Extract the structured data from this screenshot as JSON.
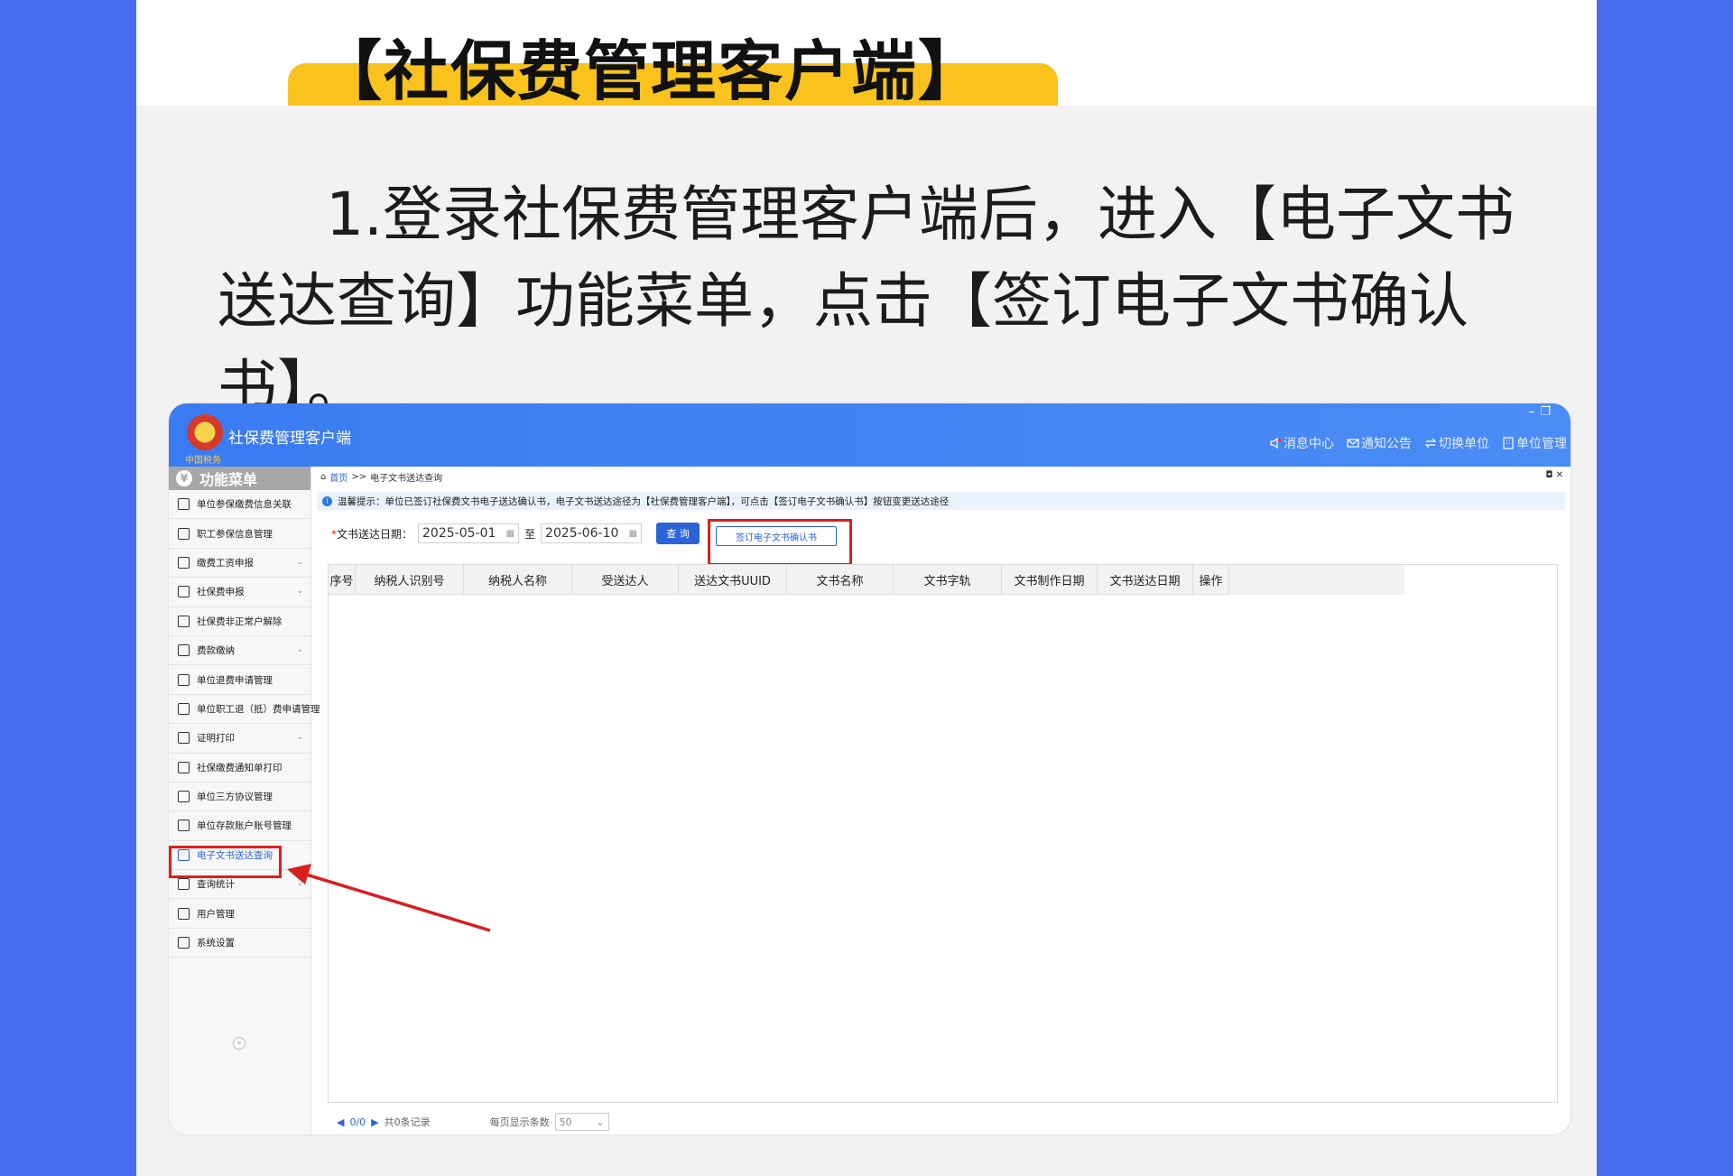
{
  "poster": {
    "title": "【社保费管理客户端】",
    "instruction": "1.登录社保费管理客户端后，进入【电子文书送达查询】功能菜单，点击【签订电子文书确认书】。"
  },
  "app": {
    "name": "社保费管理客户端",
    "logo_subtext": "中国税务",
    "window_controls": {
      "minimize": "–",
      "restore": "❐"
    },
    "header_links": [
      {
        "icon": "speaker-icon",
        "label": "消息中心"
      },
      {
        "icon": "mail-icon",
        "label": "通知公告"
      },
      {
        "icon": "swap-icon",
        "label": "切换单位"
      },
      {
        "icon": "building-icon",
        "label": "单位管理"
      }
    ]
  },
  "sidebar": {
    "title": "功能菜单",
    "items": [
      {
        "label": "单位参保缴费信息关联",
        "expandable": false
      },
      {
        "label": "职工参保信息管理",
        "expandable": false
      },
      {
        "label": "缴费工资申报",
        "expandable": true
      },
      {
        "label": "社保费申报",
        "expandable": true
      },
      {
        "label": "社保费非正常户解除",
        "expandable": false
      },
      {
        "label": "费款缴纳",
        "expandable": true
      },
      {
        "label": "单位退费申请管理",
        "expandable": false
      },
      {
        "label": "单位职工退（抵）费申请管理",
        "expandable": false
      },
      {
        "label": "证明打印",
        "expandable": true
      },
      {
        "label": "社保缴费通知单打印",
        "expandable": false
      },
      {
        "label": "单位三方协议管理",
        "expandable": false
      },
      {
        "label": "单位存款账户账号管理",
        "expandable": false
      },
      {
        "label": "电子文书送达查询",
        "expandable": false,
        "active": true
      },
      {
        "label": "查询统计",
        "expandable": true
      },
      {
        "label": "用户管理",
        "expandable": false
      },
      {
        "label": "系统设置",
        "expandable": false
      }
    ],
    "collapse_symbol": "«"
  },
  "content": {
    "breadcrumb": {
      "home": "首页",
      "separator": ">>",
      "current": "电子文书送达查询"
    },
    "tab_controls": "◘ ✕",
    "notice": "温馨提示：单位已签订社保费文书电子送达确认书，电子文书送达途径为【社保费管理客户端】，可点击【签订电子文书确认书】按钮变更送达途径",
    "filter": {
      "required_mark": "*",
      "label": "文书送达日期：",
      "start_date": "2025-05-01",
      "to": "至",
      "end_date": "2025-06-10",
      "query_button": "查 询",
      "sign_button": "签订电子文书确认书"
    },
    "table": {
      "columns": [
        "序号",
        "纳税人识别号",
        "纳税人名称",
        "受送达人",
        "送达文书UUID",
        "文书名称",
        "文书字轨",
        "文书制作日期",
        "文书送达日期",
        "操作"
      ],
      "rows": []
    },
    "pager": {
      "pages": "0/0",
      "total": "共0条记录",
      "per_page_label": "每页显示条数",
      "per_page_value": "50"
    }
  },
  "colors": {
    "accent_blue": "#2c64d8",
    "header_blue": "#3b7bf2",
    "highlight_red": "#e01e1e",
    "title_yellow": "#f9c21c",
    "background_blue": "#4a6cf0"
  }
}
